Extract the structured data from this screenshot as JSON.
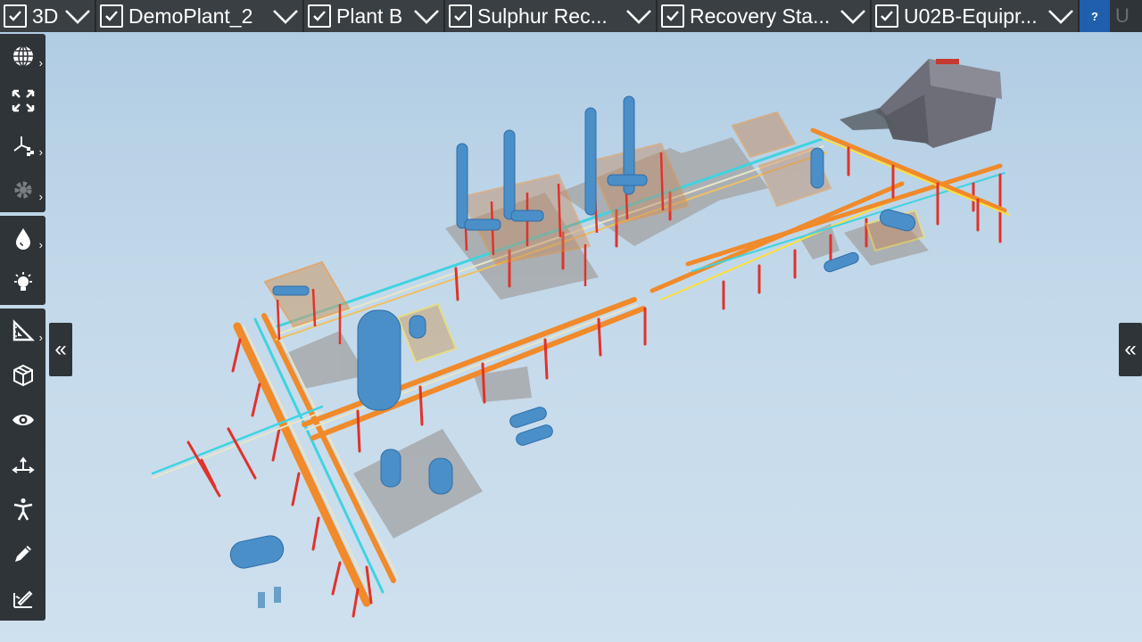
{
  "filters": [
    {
      "label": "3D",
      "checked": true
    },
    {
      "label": "DemoPlant_2",
      "checked": true
    },
    {
      "label": "Plant B",
      "checked": true
    },
    {
      "label": "Sulphur Rec...",
      "checked": true
    },
    {
      "label": "Recovery Sta...",
      "checked": true
    },
    {
      "label": "U02B-Equipr...",
      "checked": true
    }
  ],
  "help_label": "?",
  "ghost_label": "U",
  "toolbar": {
    "groups": [
      [
        "globe-icon",
        "fit-view-icon",
        "axes-icon",
        "settings-gear-icon"
      ],
      [
        "water-drop-icon",
        "light-bulb-icon"
      ],
      [
        "measure-icon",
        "box-icon",
        "eye-icon",
        "move-axis-icon",
        "walk-person-icon",
        "pencil-icon",
        "markup-icon"
      ]
    ]
  },
  "side_tabs": {
    "left": "«",
    "right": "«"
  },
  "colors": {
    "toolbar_bg": "#2f3438",
    "help_bg": "#1f5fae",
    "steel_red": "#e0322b",
    "steel_orange": "#f08a2a",
    "pipe_cyan": "#3fd3e0",
    "vessel_blue": "#4a8fc8",
    "slab_gray": "#a7a9ab"
  }
}
